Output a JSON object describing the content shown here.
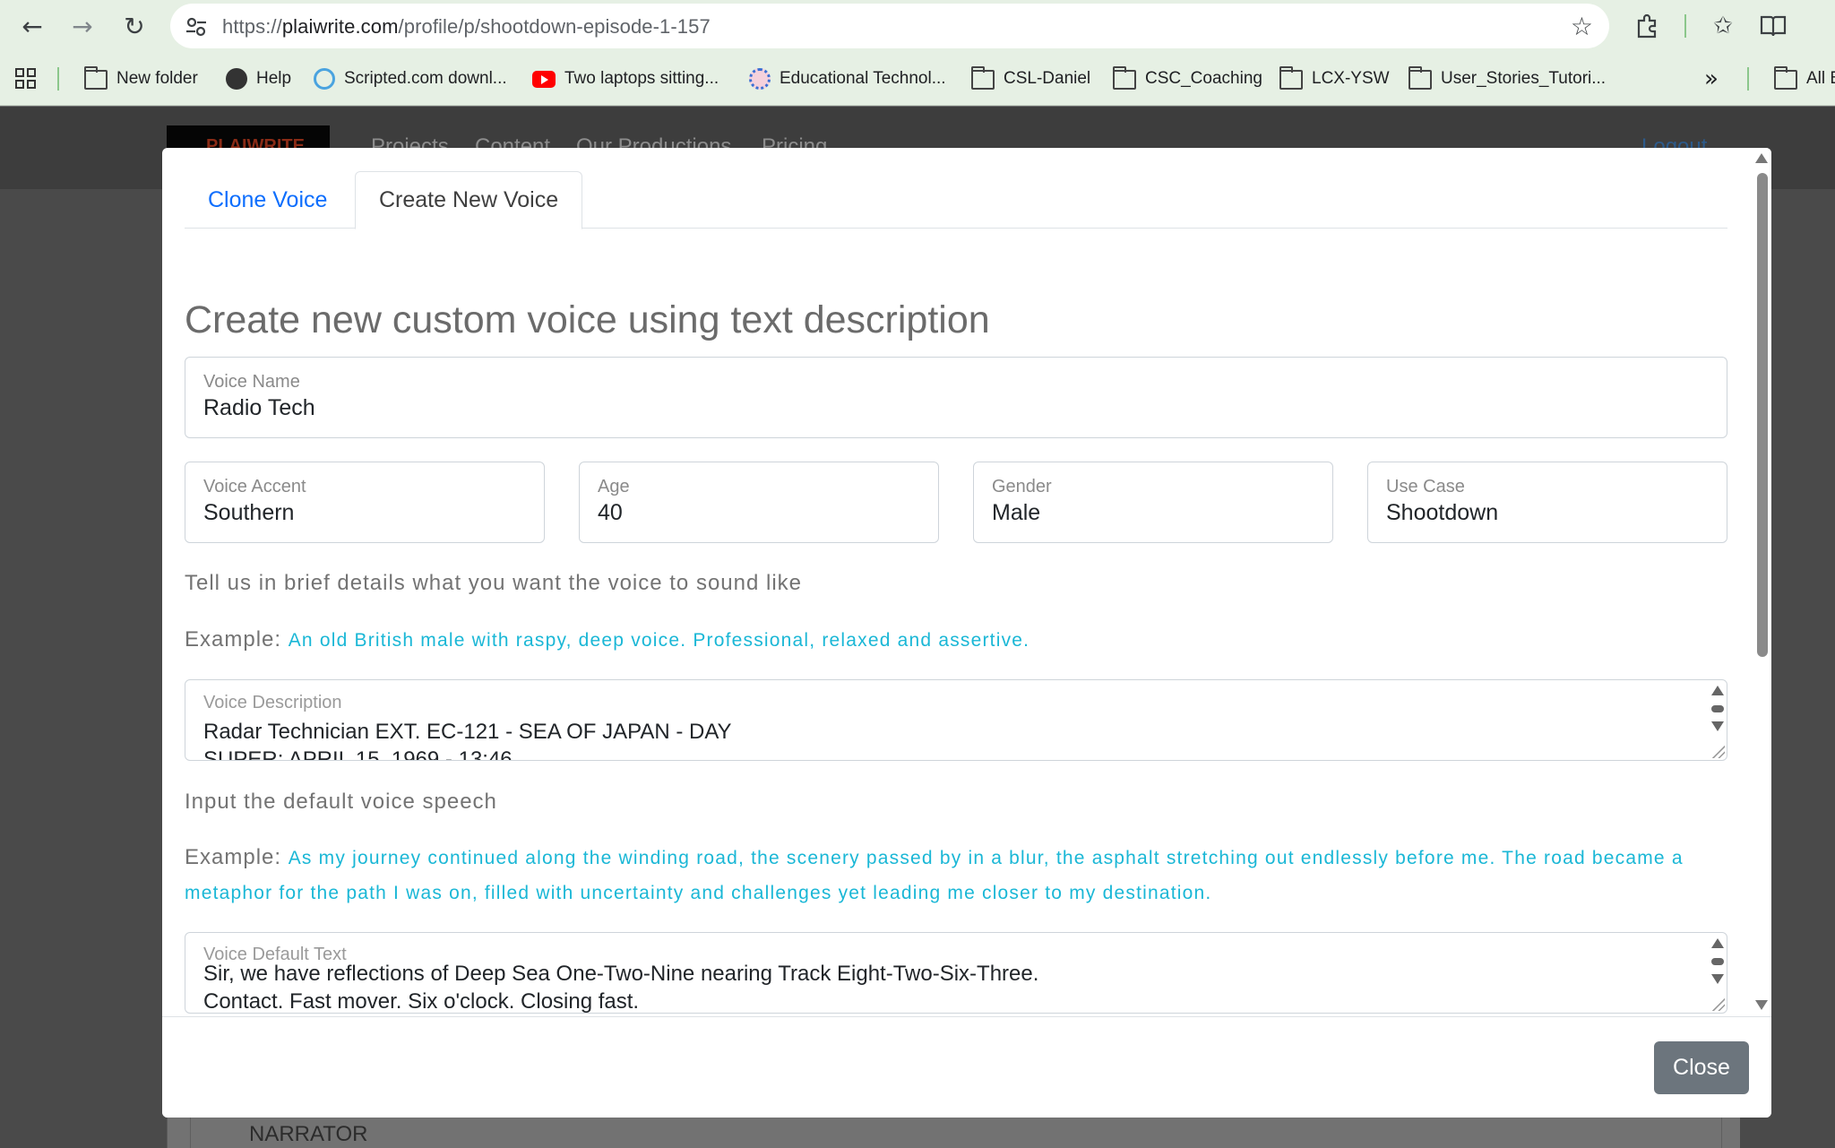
{
  "browser": {
    "url_prefix": "https://",
    "url_host": "plaiwrite.com",
    "url_path": "/profile/p/shootdown-episode-1-157",
    "bookmarks": [
      {
        "label": "New folder",
        "icon": "folder-icon"
      },
      {
        "label": "Help",
        "icon": "globe-icon"
      },
      {
        "label": "Scripted.com downl...",
        "icon": "scripted-icon"
      },
      {
        "label": "Two laptops sitting...",
        "icon": "youtube-icon"
      },
      {
        "label": "Educational Technol...",
        "icon": "edu-icon"
      },
      {
        "label": "CSL-Daniel",
        "icon": "folder-icon"
      },
      {
        "label": "CSC_Coaching",
        "icon": "folder-icon"
      },
      {
        "label": "LCX-YSW",
        "icon": "folder-icon"
      },
      {
        "label": "User_Stories_Tutori...",
        "icon": "folder-icon"
      }
    ],
    "all_bookmarks_label": "All B"
  },
  "page": {
    "logo_text": "PLAIWRITE",
    "nav": [
      "Projects",
      "Content",
      "Our Productions",
      "Pricing"
    ],
    "logout": "Logout",
    "narrator": "NARRATOR"
  },
  "modal": {
    "tabs": [
      "Clone Voice",
      "Create New Voice"
    ],
    "active_tab": "Create New Voice",
    "heading": "Create new custom voice using text description",
    "voice_name": {
      "label": "Voice Name",
      "value": "Radio Tech"
    },
    "voice_accent": {
      "label": "Voice Accent",
      "value": "Southern"
    },
    "age": {
      "label": "Age",
      "value": "40"
    },
    "gender": {
      "label": "Gender",
      "value": "Male"
    },
    "use_case": {
      "label": "Use Case",
      "value": "Shootdown"
    },
    "details_prompt": "Tell us in brief details what you want the voice to sound like",
    "example_label": "Example:",
    "description_example": "An old British male with raspy, deep voice. Professional, relaxed and assertive.",
    "voice_description": {
      "label": "Voice Description",
      "line1": "Radar Technician EXT. EC-121 - SEA OF JAPAN - DAY",
      "line2": "SUPER: APRIL 15, 1969 - 13:46"
    },
    "speech_prompt": "Input the default voice speech",
    "speech_example": "As my journey continued along the winding road, the scenery passed by in a blur, the asphalt stretching out endlessly before me. The road became a metaphor for the path I was on, filled with uncertainty and challenges yet leading me closer to my destination.",
    "voice_default_text": {
      "label": "Voice Default Text",
      "line1": "Sir, we have reflections of Deep Sea One-Two-Nine nearing Track Eight-Two-Six-Three.",
      "line2": "Contact. Fast mover. Six o'clock. Closing fast."
    },
    "close_label": "Close"
  },
  "colors": {
    "link_blue": "#0d6efd",
    "example_cyan": "#1ab7d6",
    "close_gray": "#6c757d",
    "chrome_green": "#e6f0e4"
  }
}
